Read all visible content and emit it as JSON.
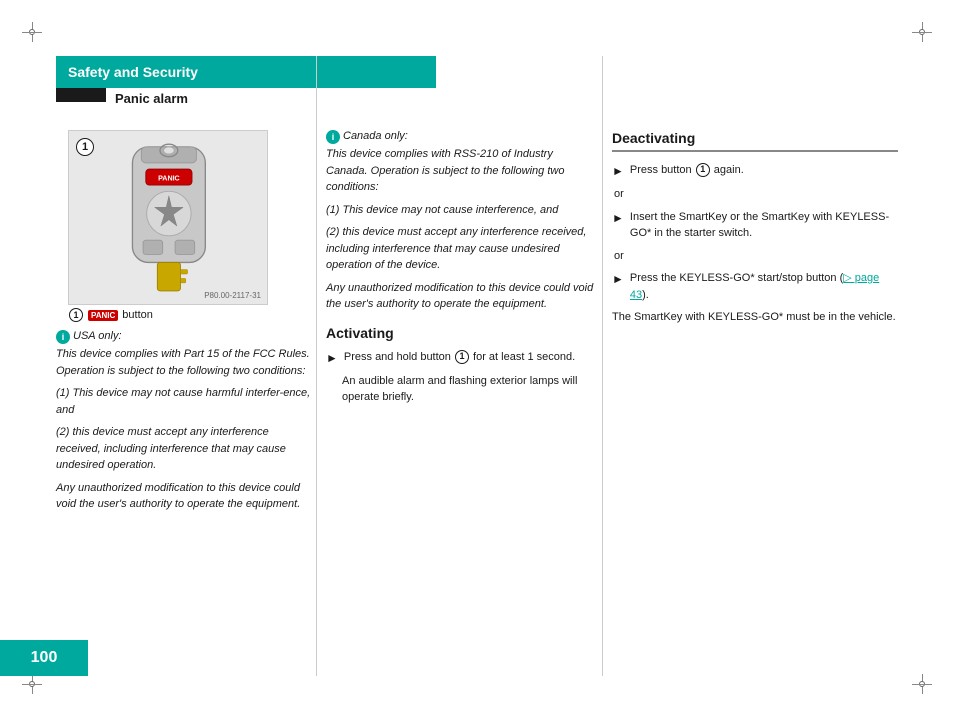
{
  "page": {
    "number": "100",
    "header": {
      "title": "Safety and Security",
      "section": "Panic alarm"
    }
  },
  "image": {
    "caption_prefix": "button",
    "panic_label": "PANIC",
    "label_number": "1",
    "p80_code": "P80.00-2117-31"
  },
  "left_col": {
    "usa_header": "USA only:",
    "usa_body": "This device complies with Part 15 of the FCC Rules. Operation is subject to the following two conditions:",
    "usa_item1": "(1)  This device may not cause harmful interfer-ence, and",
    "usa_item2": "(2)  this device must accept any interference received, including interference that may cause undesired operation.",
    "usa_note": "Any unauthorized modification to this device could void the user's authority to operate the equipment."
  },
  "mid_col": {
    "canada_header": "Canada only:",
    "canada_body": "This device complies with RSS-210 of Industry Canada. Operation is subject to the following two conditions:",
    "canada_item1": "(1)  This device may not cause interference, and",
    "canada_item2": "(2)  this device must accept any interference received, including interference that may cause undesired operation of the device.",
    "canada_note": "Any unauthorized modification to this device could void the user's authority to operate the equipment.",
    "activating_title": "Activating",
    "activating_step1": "Press and hold button",
    "activating_step1b": "for at least 1 second.",
    "activating_note": "An audible alarm and flashing exterior lamps will operate briefly."
  },
  "right_col": {
    "title": "Deactivating",
    "step1": "Press button",
    "step1b": "again.",
    "or1": "or",
    "step2": "Insert the SmartKey or the SmartKey with KEYLESS-GO* in the starter switch.",
    "or2": "or",
    "step3": "Press the KEYLESS-GO* start/stop button (",
    "step3_link": "page 43",
    "step3c": ").",
    "note": "The SmartKey with KEYLESS-GO* must be in the vehicle."
  }
}
